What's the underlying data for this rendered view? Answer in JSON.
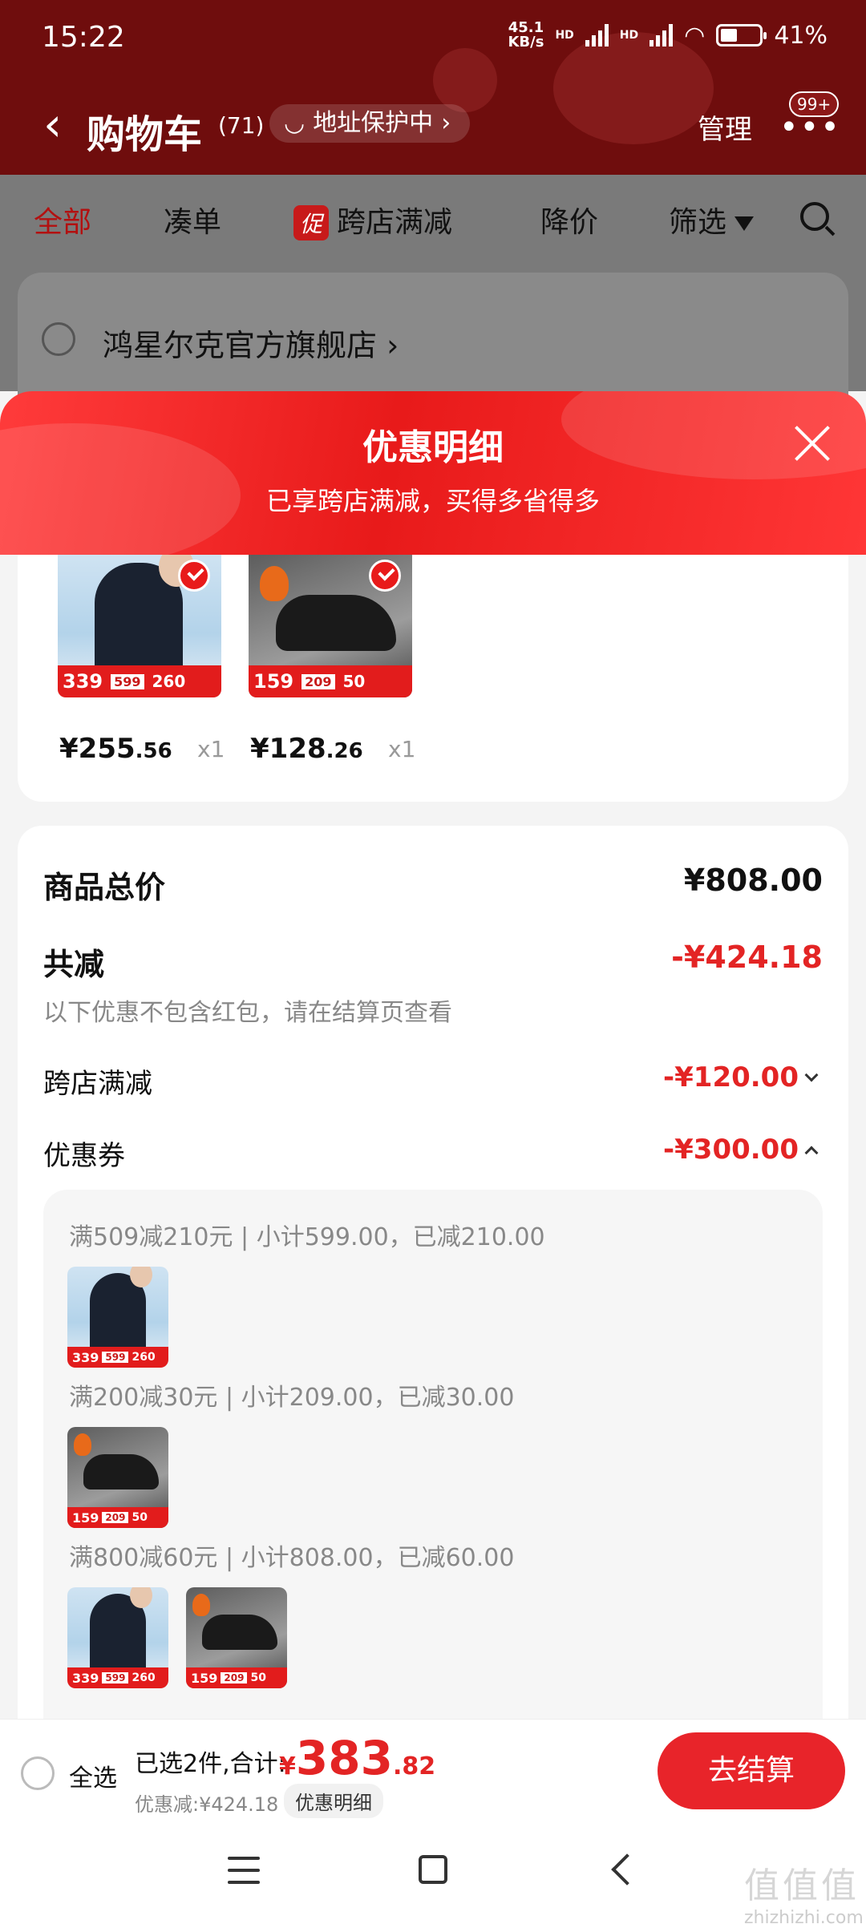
{
  "status_bar": {
    "time": "15:22",
    "net_speed": "45.1",
    "net_unit": "KB/s",
    "hd1": "HD",
    "hd2": "HD",
    "battery": "41%"
  },
  "header": {
    "back_icon": "chevron-left-icon",
    "title": "购物车",
    "count": "(71)",
    "address_protect": "地址保护中",
    "manage": "管理",
    "badge": "99+"
  },
  "tabs": [
    {
      "label": "全部",
      "active": true
    },
    {
      "label": "凑单"
    },
    {
      "label": "跨店满减",
      "badge": "促"
    },
    {
      "label": "降价"
    },
    {
      "label": "筛选"
    }
  ],
  "store": {
    "name": "鸿星尔克官方旗舰店"
  },
  "sheet": {
    "title": "优惠明细",
    "subtitle": "已享跨店满减，买得多省得多"
  },
  "products": [
    {
      "name": "jacket",
      "price_int": "¥255",
      "price_dec": ".56",
      "qty": "x1",
      "tag_price": "339",
      "tag_a": "599",
      "tag_b": "260"
    },
    {
      "name": "shoe",
      "price_int": "¥128",
      "price_dec": ".26",
      "qty": "x1",
      "tag_price": "159",
      "tag_a": "209",
      "tag_b": "50"
    }
  ],
  "summary": {
    "total_label": "商品总价",
    "total_value": "¥808.00",
    "discount_label": "共减",
    "discount_value": "-¥424.18",
    "note": "以下优惠不包含红包，请在结算页查看",
    "cross_store_label": "跨店满减",
    "cross_store_value": "-¥120.00",
    "coupon_label": "优惠券",
    "coupon_value": "-¥300.00"
  },
  "coupons": [
    {
      "text": "满509减210元 | 小计599.00，已减210.00"
    },
    {
      "text": "满200减30元 | 小计209.00，已减30.00"
    },
    {
      "text": "满800减60元 | 小计808.00，已减60.00"
    }
  ],
  "bottom": {
    "select_all": "全选",
    "selected": "已选2件,合计:",
    "currency": "¥",
    "total_int": "383",
    "total_dec": ".82",
    "discount": "优惠减:¥424.18",
    "detail_btn": "优惠明细",
    "checkout": "去结算"
  },
  "watermark": {
    "big": "值值值",
    "small": "zhizhizhi.com"
  }
}
